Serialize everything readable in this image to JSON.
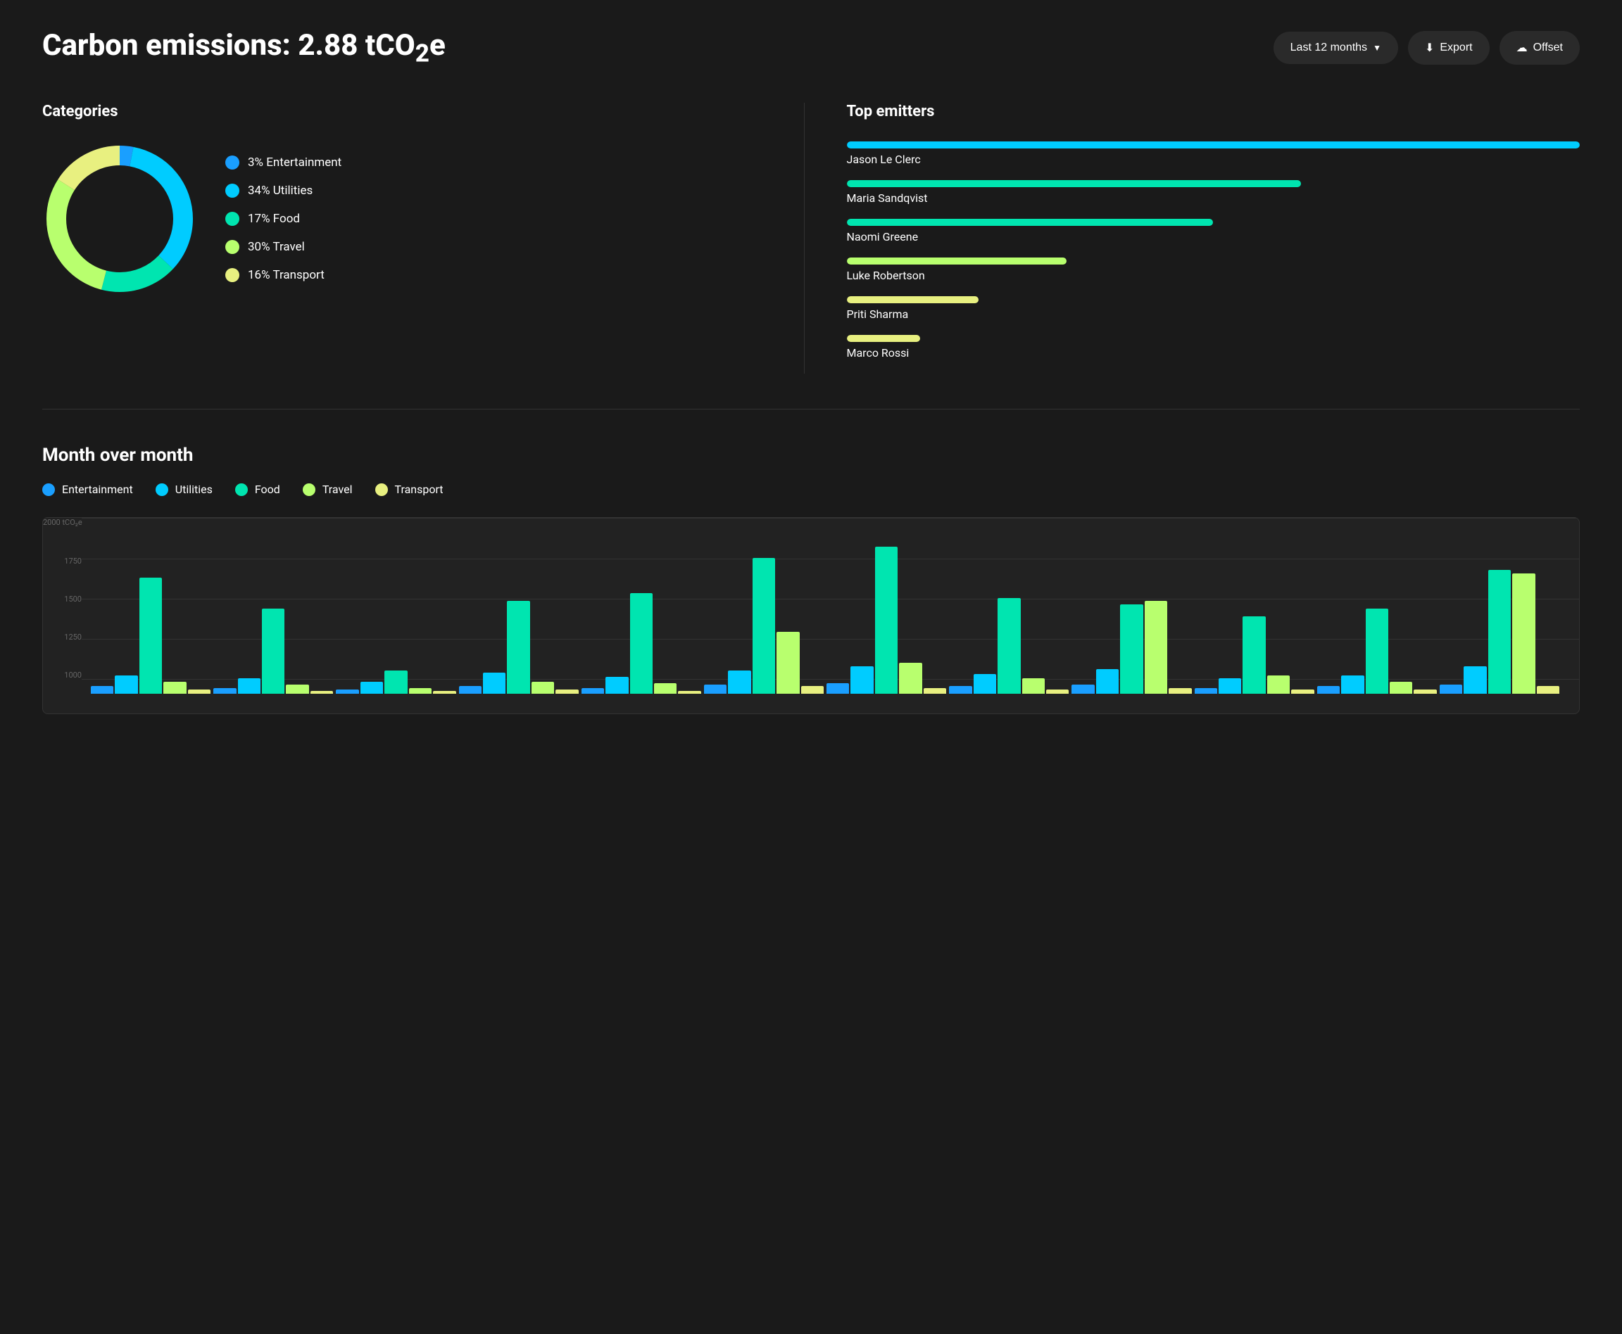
{
  "header": {
    "title": "Carbon emissions: 2.88 tCO",
    "title_sub": "2",
    "title_suffix": "e",
    "controls": {
      "period_label": "Last 12 months",
      "export_label": "Export",
      "offset_label": "Offset"
    }
  },
  "categories": {
    "panel_title": "Categories",
    "segments": [
      {
        "label": "3% Entertainment",
        "percent": 3,
        "color": "#1a9fff"
      },
      {
        "label": "34% Utilities",
        "percent": 34,
        "color": "#00ccff"
      },
      {
        "label": "17% Food",
        "percent": 17,
        "color": "#00e5b0"
      },
      {
        "label": "30% Travel",
        "percent": 30,
        "color": "#b8ff6e"
      },
      {
        "label": "16% Transport",
        "percent": 16,
        "color": "#e8f080"
      }
    ]
  },
  "top_emitters": {
    "panel_title": "Top emitters",
    "emitters": [
      {
        "name": "Jason Le Clerc",
        "bar_pct": 100,
        "color": "#00ccff"
      },
      {
        "name": "Maria Sandqvist",
        "bar_pct": 62,
        "color": "#00e5b0"
      },
      {
        "name": "Naomi Greene",
        "bar_pct": 50,
        "color": "#00e5b0"
      },
      {
        "name": "Luke Robertson",
        "bar_pct": 30,
        "color": "#b8ff6e"
      },
      {
        "name": "Priti Sharma",
        "bar_pct": 18,
        "color": "#e8f080"
      },
      {
        "name": "Marco Rossi",
        "bar_pct": 10,
        "color": "#e8f080"
      }
    ]
  },
  "mom": {
    "title": "Month over month",
    "legend": [
      {
        "label": "Entertainment",
        "color": "#1a9fff"
      },
      {
        "label": "Utilities",
        "color": "#00ccff"
      },
      {
        "label": "Food",
        "color": "#00e5b0"
      },
      {
        "label": "Travel",
        "color": "#b8ff6e"
      },
      {
        "label": "Transport",
        "color": "#e8f080"
      }
    ],
    "y_labels": [
      "2000 tCO₂e",
      "1750",
      "1500",
      "1250",
      "1000"
    ],
    "months": [
      {
        "bars": [
          {
            "height_pct": 5,
            "color": "#1a9fff"
          },
          {
            "height_pct": 12,
            "color": "#00ccff"
          },
          {
            "height_pct": 75,
            "color": "#00e5b0"
          },
          {
            "height_pct": 8,
            "color": "#b8ff6e"
          },
          {
            "height_pct": 3,
            "color": "#e8f080"
          }
        ]
      },
      {
        "bars": [
          {
            "height_pct": 4,
            "color": "#1a9fff"
          },
          {
            "height_pct": 10,
            "color": "#00ccff"
          },
          {
            "height_pct": 55,
            "color": "#00e5b0"
          },
          {
            "height_pct": 6,
            "color": "#b8ff6e"
          },
          {
            "height_pct": 2,
            "color": "#e8f080"
          }
        ]
      },
      {
        "bars": [
          {
            "height_pct": 3,
            "color": "#1a9fff"
          },
          {
            "height_pct": 8,
            "color": "#00ccff"
          },
          {
            "height_pct": 15,
            "color": "#00e5b0"
          },
          {
            "height_pct": 4,
            "color": "#b8ff6e"
          },
          {
            "height_pct": 2,
            "color": "#e8f080"
          }
        ]
      },
      {
        "bars": [
          {
            "height_pct": 5,
            "color": "#1a9fff"
          },
          {
            "height_pct": 14,
            "color": "#00ccff"
          },
          {
            "height_pct": 60,
            "color": "#00e5b0"
          },
          {
            "height_pct": 8,
            "color": "#b8ff6e"
          },
          {
            "height_pct": 3,
            "color": "#e8f080"
          }
        ]
      },
      {
        "bars": [
          {
            "height_pct": 4,
            "color": "#1a9fff"
          },
          {
            "height_pct": 11,
            "color": "#00ccff"
          },
          {
            "height_pct": 65,
            "color": "#00e5b0"
          },
          {
            "height_pct": 7,
            "color": "#b8ff6e"
          },
          {
            "height_pct": 2,
            "color": "#e8f080"
          }
        ]
      },
      {
        "bars": [
          {
            "height_pct": 6,
            "color": "#1a9fff"
          },
          {
            "height_pct": 15,
            "color": "#00ccff"
          },
          {
            "height_pct": 88,
            "color": "#00e5b0"
          },
          {
            "height_pct": 40,
            "color": "#b8ff6e"
          },
          {
            "height_pct": 5,
            "color": "#e8f080"
          }
        ]
      },
      {
        "bars": [
          {
            "height_pct": 7,
            "color": "#1a9fff"
          },
          {
            "height_pct": 18,
            "color": "#00ccff"
          },
          {
            "height_pct": 95,
            "color": "#00e5b0"
          },
          {
            "height_pct": 20,
            "color": "#b8ff6e"
          },
          {
            "height_pct": 4,
            "color": "#e8f080"
          }
        ]
      },
      {
        "bars": [
          {
            "height_pct": 5,
            "color": "#1a9fff"
          },
          {
            "height_pct": 13,
            "color": "#00ccff"
          },
          {
            "height_pct": 62,
            "color": "#00e5b0"
          },
          {
            "height_pct": 10,
            "color": "#b8ff6e"
          },
          {
            "height_pct": 3,
            "color": "#e8f080"
          }
        ]
      },
      {
        "bars": [
          {
            "height_pct": 6,
            "color": "#1a9fff"
          },
          {
            "height_pct": 16,
            "color": "#00ccff"
          },
          {
            "height_pct": 58,
            "color": "#00e5b0"
          },
          {
            "height_pct": 60,
            "color": "#b8ff6e"
          },
          {
            "height_pct": 4,
            "color": "#e8f080"
          }
        ]
      },
      {
        "bars": [
          {
            "height_pct": 4,
            "color": "#1a9fff"
          },
          {
            "height_pct": 10,
            "color": "#00ccff"
          },
          {
            "height_pct": 50,
            "color": "#00e5b0"
          },
          {
            "height_pct": 12,
            "color": "#b8ff6e"
          },
          {
            "height_pct": 3,
            "color": "#e8f080"
          }
        ]
      },
      {
        "bars": [
          {
            "height_pct": 5,
            "color": "#1a9fff"
          },
          {
            "height_pct": 12,
            "color": "#00ccff"
          },
          {
            "height_pct": 55,
            "color": "#00e5b0"
          },
          {
            "height_pct": 8,
            "color": "#b8ff6e"
          },
          {
            "height_pct": 3,
            "color": "#e8f080"
          }
        ]
      },
      {
        "bars": [
          {
            "height_pct": 6,
            "color": "#1a9fff"
          },
          {
            "height_pct": 18,
            "color": "#00ccff"
          },
          {
            "height_pct": 80,
            "color": "#00e5b0"
          },
          {
            "height_pct": 78,
            "color": "#b8ff6e"
          },
          {
            "height_pct": 5,
            "color": "#e8f080"
          }
        ]
      }
    ]
  }
}
